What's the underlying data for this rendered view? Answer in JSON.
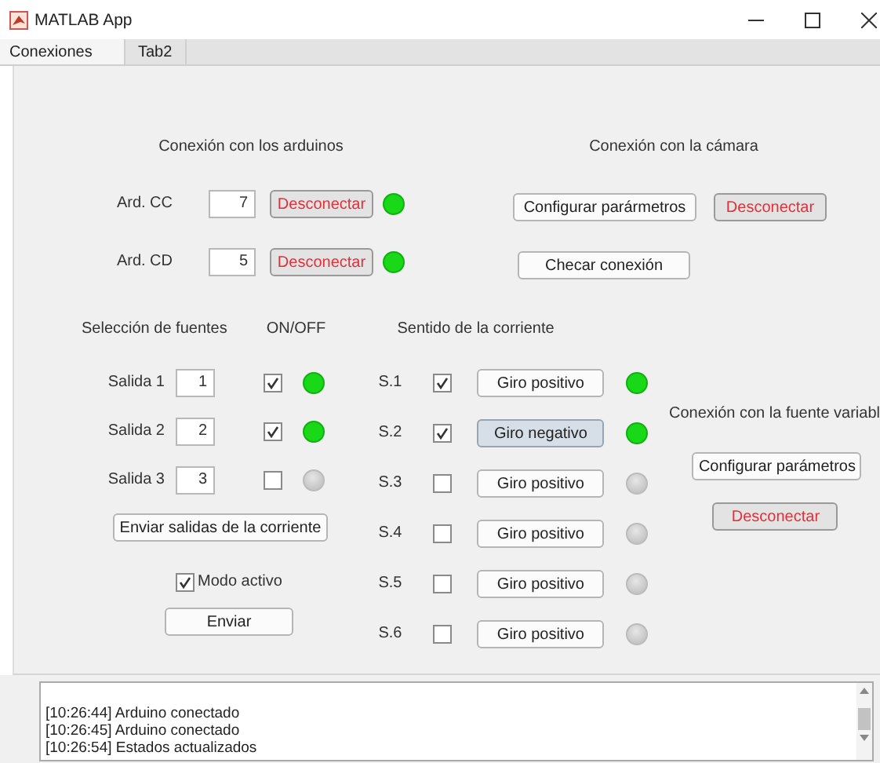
{
  "window": {
    "title": "MATLAB App"
  },
  "tabs": [
    {
      "label": "Conexiones",
      "selected": true
    },
    {
      "label": "Tab2",
      "selected": false
    }
  ],
  "arduinos": {
    "title": "Conexión con los arduinos",
    "rows": [
      {
        "label": "Ard. CC",
        "value": "7",
        "button": "Desconectar",
        "on": true
      },
      {
        "label": "Ard. CD",
        "value": "5",
        "button": "Desconectar",
        "on": true
      }
    ]
  },
  "camera": {
    "title": "Conexión con la cámara",
    "buttons": [
      {
        "label": "Configurar parármetros",
        "kind": "normal"
      },
      {
        "label": "Desconectar",
        "kind": "danger"
      },
      {
        "label": "Checar conexión",
        "kind": "normal"
      }
    ]
  },
  "sources": {
    "title": "Selección de fuentes",
    "onoff_header": "ON/OFF",
    "rows": [
      {
        "label": "Salida 1",
        "value": "1",
        "checked": true,
        "on": true
      },
      {
        "label": "Salida 2",
        "value": "2",
        "checked": true,
        "on": true
      },
      {
        "label": "Salida 3",
        "value": "3",
        "checked": false,
        "on": false
      }
    ],
    "send_outputs": "Enviar salidas de la corriente",
    "mode": {
      "label": "Modo activo",
      "checked": true
    },
    "send": "Enviar"
  },
  "direction": {
    "title": "Sentido de la corriente",
    "rows": [
      {
        "label": "S.1",
        "checked": true,
        "button": "Giro positivo",
        "selected": false,
        "on": true
      },
      {
        "label": "S.2",
        "checked": true,
        "button": "Giro negativo",
        "selected": true,
        "on": true
      },
      {
        "label": "S.3",
        "checked": false,
        "button": "Giro positivo",
        "selected": false,
        "on": false
      },
      {
        "label": "S.4",
        "checked": false,
        "button": "Giro positivo",
        "selected": false,
        "on": false
      },
      {
        "label": "S.5",
        "checked": false,
        "button": "Giro positivo",
        "selected": false,
        "on": false
      },
      {
        "label": "S.6",
        "checked": false,
        "button": "Giro positivo",
        "selected": false,
        "on": false
      }
    ]
  },
  "variable_source": {
    "title": "Conexión con la fuente variabl",
    "buttons": [
      {
        "label": "Configurar parámetros",
        "kind": "normal"
      },
      {
        "label": "Desconectar",
        "kind": "danger"
      }
    ]
  },
  "log": {
    "lines": [
      "[10:26:44] Arduino conectado",
      "[10:26:45] Arduino conectado",
      "[10:26:54] Estados actualizados"
    ]
  }
}
